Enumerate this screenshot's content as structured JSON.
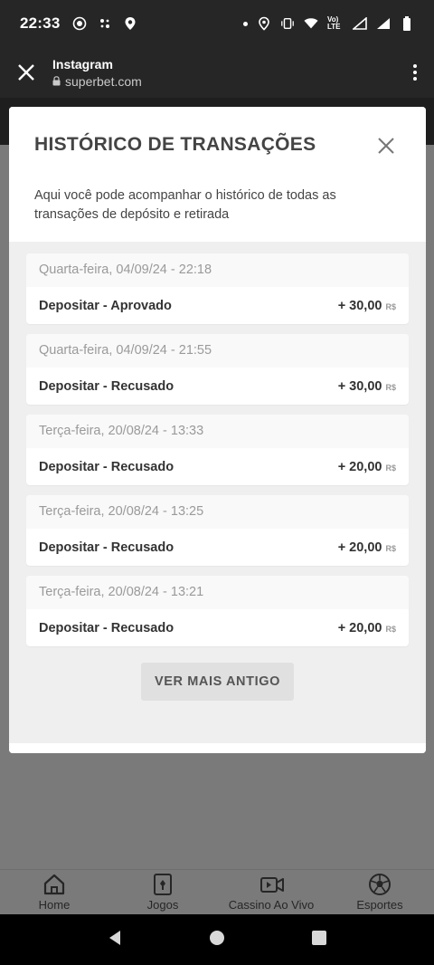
{
  "status_bar": {
    "time": "22:33",
    "network_label": "Vo) LTE"
  },
  "browser": {
    "title": "Instagram",
    "url": "superbet.com"
  },
  "modal": {
    "title": "HISTÓRICO DE TRANSAÇÕES",
    "description": "Aqui você pode acompanhar o histórico de todas as transações de depósito e retirada",
    "transactions": [
      {
        "date": "Quarta-feira, 04/09/24 - 22:18",
        "label": "Depositar - Aprovado",
        "amount": "+ 30,00",
        "currency": "R$"
      },
      {
        "date": "Quarta-feira, 04/09/24 - 21:55",
        "label": "Depositar - Recusado",
        "amount": "+ 30,00",
        "currency": "R$"
      },
      {
        "date": "Terça-feira, 20/08/24 - 13:33",
        "label": "Depositar - Recusado",
        "amount": "+ 20,00",
        "currency": "R$"
      },
      {
        "date": "Terça-feira, 20/08/24 - 13:25",
        "label": "Depositar - Recusado",
        "amount": "+ 20,00",
        "currency": "R$"
      },
      {
        "date": "Terça-feira, 20/08/24 - 13:21",
        "label": "Depositar - Recusado",
        "amount": "+ 20,00",
        "currency": "R$"
      }
    ],
    "more_button": "VER MAIS ANTIGO"
  },
  "bottom_nav": {
    "items": [
      {
        "label": "Home",
        "icon": "home-icon"
      },
      {
        "label": "Jogos",
        "icon": "cards-icon"
      },
      {
        "label": "Cassino Ao Vivo",
        "icon": "live-camera-icon"
      },
      {
        "label": "Esportes",
        "icon": "soccer-ball-icon"
      }
    ]
  },
  "colors": {
    "status_bg": "#262626",
    "overlay_gray": "#7a7a7a",
    "modal_bg": "#ffffff",
    "modal_body_bg": "#efefef",
    "title_text": "#444444"
  }
}
